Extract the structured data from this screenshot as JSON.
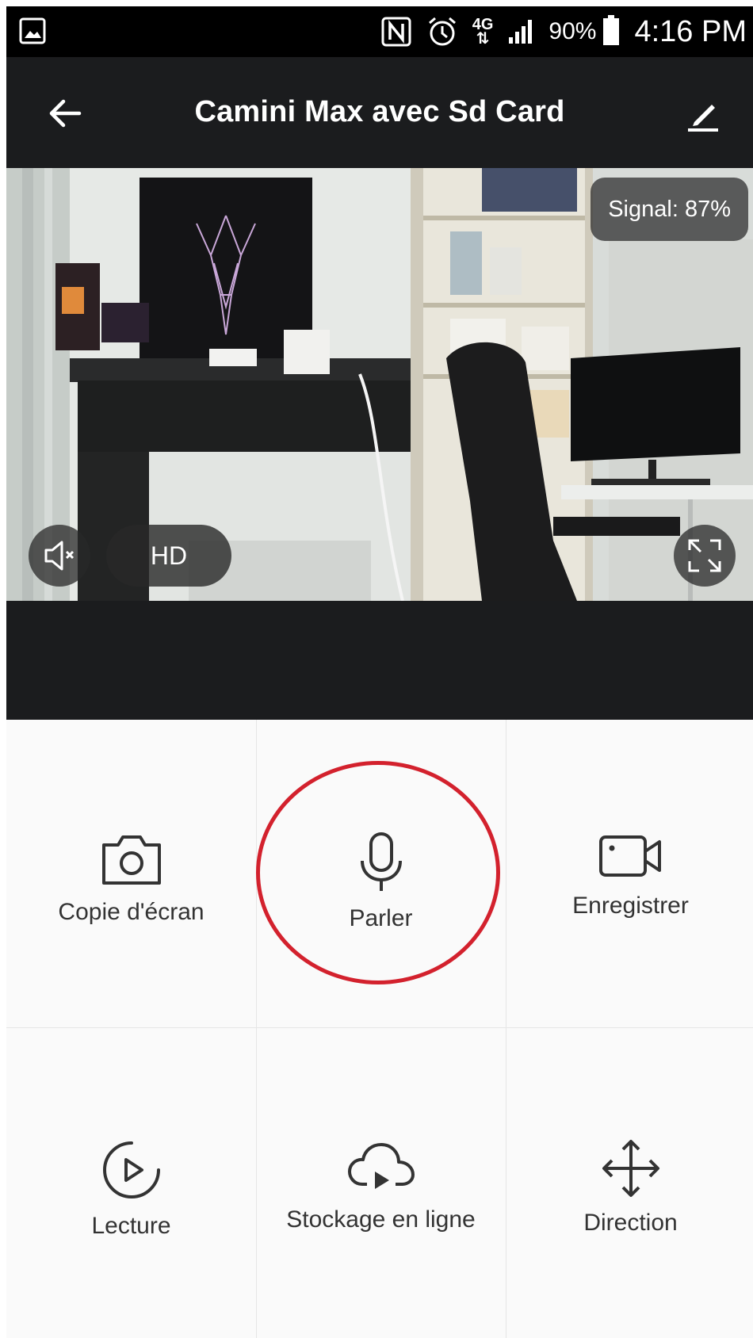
{
  "status_bar": {
    "battery": "90%",
    "time": "4:16 PM",
    "network": "4G",
    "icons": [
      "gallery-icon",
      "nfc-icon",
      "alarm-icon",
      "network-4g-icon",
      "signal-bars-icon",
      "battery-icon"
    ]
  },
  "header": {
    "title": "Camini Max avec Sd Card",
    "back_icon": "arrow-left-icon",
    "edit_icon": "pencil-icon"
  },
  "video": {
    "signal_text": "Signal: 87%",
    "quality_label": "HD",
    "mute_icon": "speaker-muted-icon",
    "fullscreen_icon": "fullscreen-icon"
  },
  "controls": [
    {
      "label": "Copie d'écran",
      "icon": "camera-icon"
    },
    {
      "label": "Parler",
      "icon": "microphone-icon",
      "highlighted": true
    },
    {
      "label": "Enregistrer",
      "icon": "video-camera-icon"
    },
    {
      "label": "Lecture",
      "icon": "playback-icon"
    },
    {
      "label": "Stockage en ligne",
      "icon": "cloud-play-icon"
    },
    {
      "label": "Direction",
      "icon": "move-arrows-icon"
    }
  ],
  "colors": {
    "header_bg": "#1b1c1e",
    "highlight_ring": "#d3212d",
    "text": "#333333"
  }
}
